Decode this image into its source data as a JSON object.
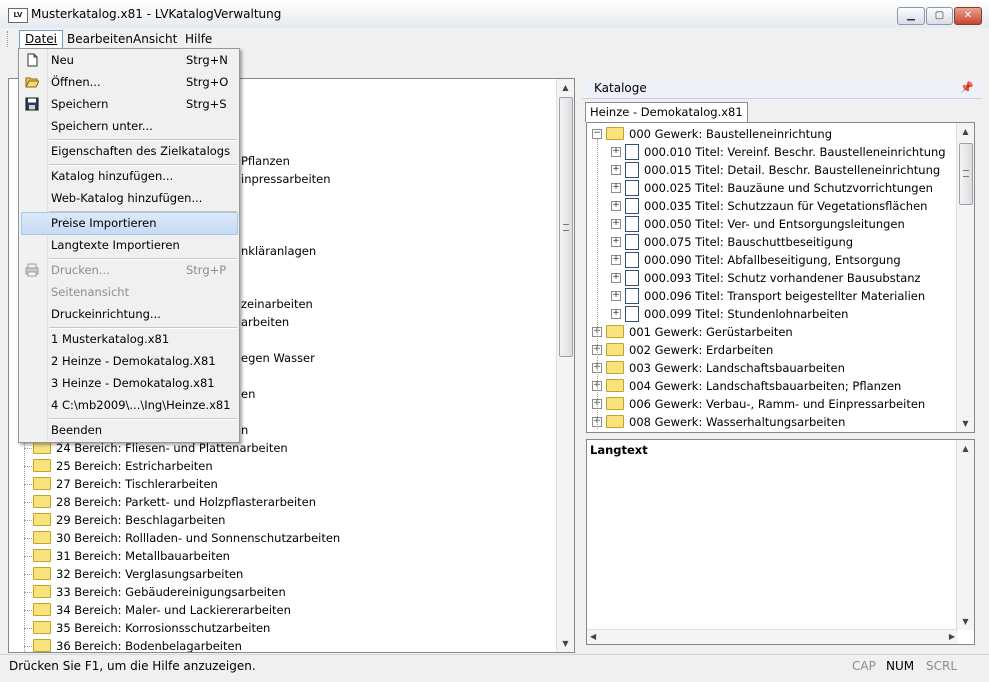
{
  "window": {
    "title": "Musterkatalog.x81 - LVKatalogVerwaltung",
    "app_icon_text": "LV"
  },
  "menubar": [
    "Datei",
    "Bearbeiten",
    "Ansicht",
    "Hilfe"
  ],
  "file_menu": {
    "items": [
      {
        "label": "Neu",
        "shortcut": "Strg+N",
        "icon": "new-document-icon"
      },
      {
        "label": "Öffnen...",
        "shortcut": "Strg+O",
        "icon": "open-folder-icon"
      },
      {
        "label": "Speichern",
        "shortcut": "Strg+S",
        "icon": "save-disk-icon"
      },
      {
        "label": "Speichern unter..."
      },
      {
        "label": "Eigenschaften des Zielkatalogs"
      },
      {
        "label": "Katalog hinzufügen..."
      },
      {
        "label": "Web-Katalog hinzufügen..."
      },
      {
        "label": "Preise Importieren"
      },
      {
        "label": "Langtexte Importieren"
      },
      {
        "label": "Drucken...",
        "shortcut": "Strg+P",
        "icon": "printer-icon"
      },
      {
        "label": "Seitenansicht"
      },
      {
        "label": "Druckeinrichtung..."
      },
      {
        "label": "1 Musterkatalog.x81"
      },
      {
        "label": "2 Heinze - Demokatalog.X81"
      },
      {
        "label": "3 Heinze - Demokatalog.x81"
      },
      {
        "label": "4 C:\\mb2009\\...\\Ing\\Heinze.x81"
      },
      {
        "label": "Beenden"
      }
    ]
  },
  "left_tree": {
    "partial_visible": [
      "Pflanzen",
      "inpressarbeiten",
      "nkläranlagen",
      "zeinarbeiten",
      "arbeiten",
      "egen Wasser",
      "en",
      "n"
    ],
    "items": [
      "24  Bereich: Fliesen- und Plattenarbeiten",
      "25  Bereich: Estricharbeiten",
      "27  Bereich: Tischlerarbeiten",
      "28  Bereich: Parkett- und Holzpflasterarbeiten",
      "29  Bereich: Beschlagarbeiten",
      "30  Bereich: Rollladen- und Sonnenschutzarbeiten",
      "31  Bereich: Metallbauarbeiten",
      "32  Bereich: Verglasungsarbeiten",
      "33  Bereich: Gebäudereinigungsarbeiten",
      "34  Bereich: Maler- und Lackiererarbeiten",
      "35  Bereich: Korrosionsschutzarbeiten",
      "36  Bereich: Bodenbelagarbeiten"
    ]
  },
  "right_panel": {
    "title": "Kataloge",
    "pin_icon": "pin-icon",
    "tab": "Heinze - Demokatalog.x81",
    "tree": [
      {
        "label": "000 Gewerk: Baustelleneinrichtung",
        "level": 0,
        "type": "folder",
        "expanded": true
      },
      {
        "label": "000.010 Titel: Vereinf. Beschr. Baustelleneinrichtung",
        "level": 1,
        "type": "doc"
      },
      {
        "label": "000.015 Titel: Detail. Beschr. Baustelleneinrichtung",
        "level": 1,
        "type": "doc"
      },
      {
        "label": "000.025 Titel: Bauzäune und Schutzvorrichtungen",
        "level": 1,
        "type": "doc"
      },
      {
        "label": "000.035 Titel: Schutzzaun für Vegetationsflächen",
        "level": 1,
        "type": "doc"
      },
      {
        "label": "000.050 Titel: Ver- und Entsorgungsleitungen",
        "level": 1,
        "type": "doc"
      },
      {
        "label": "000.075 Titel: Bauschuttbeseitigung",
        "level": 1,
        "type": "doc"
      },
      {
        "label": "000.090 Titel: Abfallbeseitigung, Entsorgung",
        "level": 1,
        "type": "doc"
      },
      {
        "label": "000.093 Titel: Schutz vorhandener Bausubstanz",
        "level": 1,
        "type": "doc"
      },
      {
        "label": "000.096 Titel: Transport beigestellter Materialien",
        "level": 1,
        "type": "doc"
      },
      {
        "label": "000.099 Titel: Stundenlohnarbeiten",
        "level": 1,
        "type": "doc"
      },
      {
        "label": "001 Gewerk: Gerüstarbeiten",
        "level": 0,
        "type": "folder"
      },
      {
        "label": "002 Gewerk: Erdarbeiten",
        "level": 0,
        "type": "folder"
      },
      {
        "label": "003 Gewerk: Landschaftsbauarbeiten",
        "level": 0,
        "type": "folder"
      },
      {
        "label": "004 Gewerk: Landschaftsbauarbeiten; Pflanzen",
        "level": 0,
        "type": "folder"
      },
      {
        "label": "006 Gewerk: Verbau-, Ramm- und Einpressarbeiten",
        "level": 0,
        "type": "folder"
      },
      {
        "label": "008 Gewerk: Wasserhaltungsarbeiten",
        "level": 0,
        "type": "folder"
      }
    ],
    "langtext_label": "Langtext"
  },
  "statusbar": {
    "message": "Drücken Sie F1, um die Hilfe anzuzeigen.",
    "indicators": [
      "CAP",
      "NUM",
      "SCRL"
    ]
  },
  "colors": {
    "highlight": "#c6dbf4",
    "folder": "#f7e27b",
    "indicator_on": "#000000",
    "indicator_off": "#8d8d8d"
  }
}
